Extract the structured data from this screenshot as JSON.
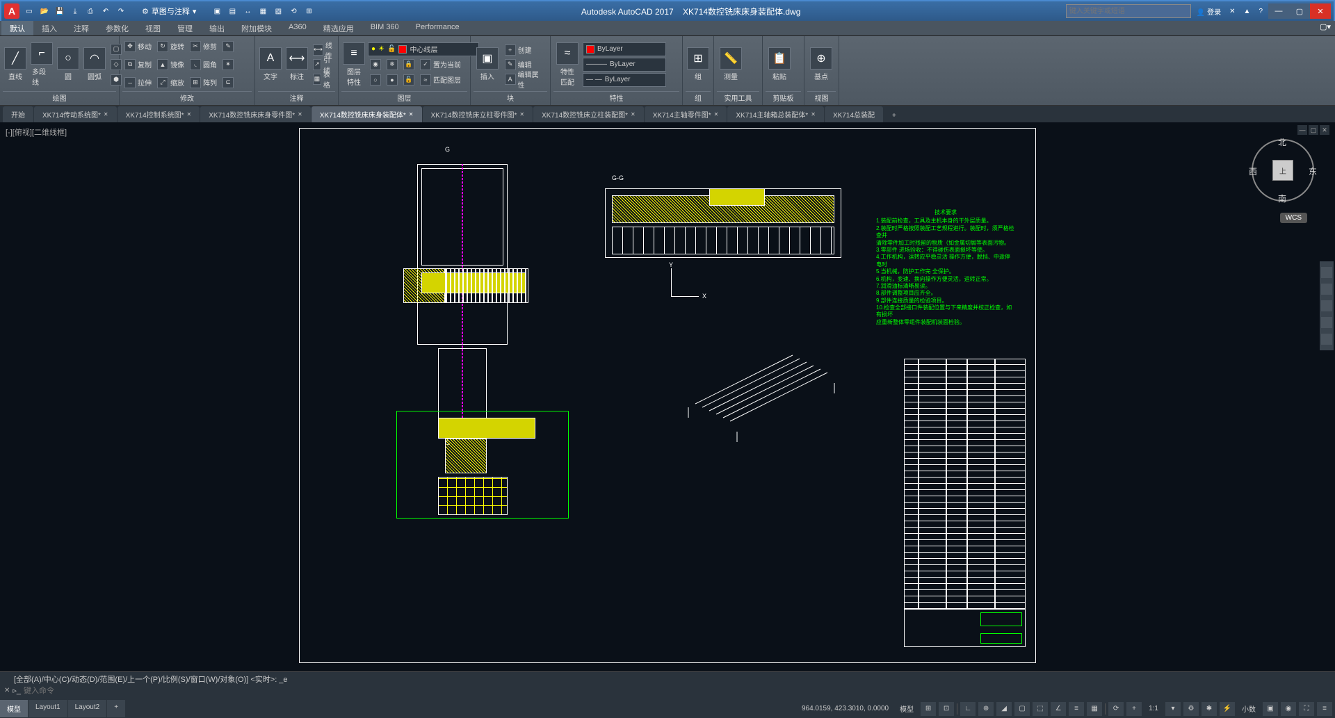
{
  "app": {
    "logo": "A",
    "title": "Autodesk AutoCAD 2017",
    "filename": "XK714数控铣床床身装配体.dwg",
    "workspace": "草图与注释",
    "search_placeholder": "键入关键字或短语",
    "login": "登录",
    "wcs": "WCS"
  },
  "ribbon_tabs": [
    "默认",
    "插入",
    "注释",
    "参数化",
    "视图",
    "管理",
    "输出",
    "附加模块",
    "A360",
    "精选应用",
    "BIM 360",
    "Performance"
  ],
  "panels": {
    "draw": {
      "label": "绘图",
      "line": "直线",
      "polyline": "多段线",
      "circle": "圆",
      "arc": "圆弧"
    },
    "modify": {
      "label": "修改",
      "move": "移动",
      "rotate": "旋转",
      "trim": "修剪",
      "copy": "复制",
      "mirror": "镜像",
      "fillet": "圆角",
      "stretch": "拉伸",
      "scale": "缩放",
      "array": "阵列"
    },
    "annot": {
      "label": "注释",
      "text": "文字",
      "dim": "标注",
      "leader": "引线",
      "table": "表格",
      "linetype": "线性"
    },
    "layer": {
      "label": "图层",
      "props": "图层\n特性",
      "current": "中心线层",
      "make_current": "置为当前",
      "match": "匹配图层"
    },
    "block": {
      "label": "块",
      "insert": "插入",
      "create": "创建",
      "edit": "编辑",
      "attr": "编辑属性"
    },
    "props": {
      "label": "特性",
      "match": "特性\n匹配",
      "color": "ByLayer",
      "lw": "ByLayer",
      "lt": "ByLayer"
    },
    "group": {
      "label": "组",
      "group": "组"
    },
    "util": {
      "label": "实用工具",
      "measure": "测量"
    },
    "clip": {
      "label": "剪贴板",
      "paste": "粘贴"
    },
    "view": {
      "label": "视图",
      "base": "基点"
    }
  },
  "file_tabs": [
    "开始",
    "XK714传动系统图*",
    "XK714控制系统图*",
    "XK714数控铣床床身零件图*",
    "XK714数控铣床床身装配体*",
    "XK714数控铣床立柱零件图*",
    "XK714数控铣床立柱装配图*",
    "XK714主轴零件图*",
    "XK714主轴箱总装配体*",
    "XK714总装配"
  ],
  "active_file_tab": 4,
  "viewport_label": "[-][俯视][二维线框]",
  "viewcube": {
    "top": "上",
    "n": "北",
    "s": "南",
    "e": "东",
    "w": "西"
  },
  "drawing": {
    "section_g": "G",
    "section_gg": "G-G",
    "ucs_x": "X",
    "ucs_y": "Y",
    "notes_title": "技术要求",
    "notes": [
      "1.装配前检查，工具及主机本身的干外层质量。",
      "2.装配时严格按照装配工艺规程进行。装配时，须严格检查并",
      "清除零件加工时残留的物质（如金属切屑等表面污物。",
      "3.零部件 进场验收：不得碰伤表面损坏等使。",
      "4.工作机构，运转应平稳灵活 操作方便，脱挡、中途停电时",
      "5.当机械，防护工作完 全保护。",
      "6.机构，变速、换向操作方便灵活，运转正常。",
      "7.润滑油标清晰易读。",
      "8.部件调整项目应齐全。",
      "9.部件连接质量的检验项目。",
      "10.检查全部接口件装配位置与下来精度并校正检查，如有损坏",
      "应重新整体零组件装配机装面检验。"
    ]
  },
  "cmd": {
    "history": "[全部(A)/中心(C)/动态(D)/范围(E)/上一个(P)/比例(S)/窗口(W)/对象(O)] <实时>: _e",
    "prompt": "键入命令"
  },
  "layout_tabs": [
    "模型",
    "Layout1",
    "Layout2"
  ],
  "status": {
    "coords": "964.0159, 423.3010, 0.0000",
    "space": "模型",
    "scale": "1:1",
    "decimals": "小数"
  }
}
